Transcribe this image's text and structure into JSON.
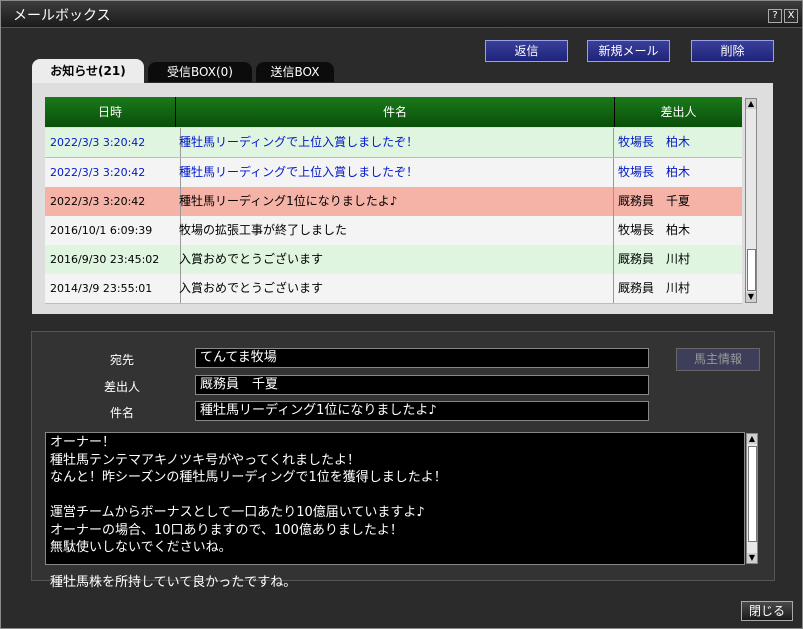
{
  "window": {
    "title": "メールボックス",
    "help": "?",
    "close": "X"
  },
  "actions": {
    "reply": "返信",
    "new_mail": "新規メール",
    "delete": "削除"
  },
  "tabs": [
    {
      "label": "お知らせ(21)"
    },
    {
      "label": "受信BOX(0)"
    },
    {
      "label": "送信BOX"
    }
  ],
  "table": {
    "columns": [
      "日時",
      "件名",
      "差出人"
    ],
    "rows": [
      {
        "date": "2022/3/3 3:20:42",
        "subject": "種牡馬リーディングで上位入賞しましたぞ！",
        "sender": "牧場長　柏木"
      },
      {
        "date": "2022/3/3 3:20:42",
        "subject": "種牡馬リーディングで上位入賞しましたぞ！",
        "sender": "牧場長　柏木"
      },
      {
        "date": "2022/3/3 3:20:42",
        "subject": "種牡馬リーディング1位になりましたよ♪",
        "sender": "厩務員　千夏"
      },
      {
        "date": "2016/10/1 6:09:39",
        "subject": "牧場の拡張工事が終了しました",
        "sender": "牧場長　柏木"
      },
      {
        "date": "2016/9/30 23:45:02",
        "subject": "入賞おめでとうございます",
        "sender": "厩務員　川村"
      },
      {
        "date": "2014/3/9 23:55:01",
        "subject": "入賞おめでとうございます",
        "sender": "厩務員　川村"
      }
    ]
  },
  "detail": {
    "to_label": "宛先",
    "to": "てんてま牧場",
    "from_label": "差出人",
    "from": "厩務員　千夏",
    "subject_label": "件名",
    "subject": "種牡馬リーディング1位になりましたよ♪",
    "owner_info": "馬主情報",
    "body": "オーナー！\n種牡馬テンテマアキノツキ号がやってくれましたよ！\nなんと！昨シーズンの種牡馬リーディングで1位を獲得しましたよ！\n\n運営チームからボーナスとして一口あたり10億届いていますよ♪\nオーナーの場合、10口ありますので、100億ありましたよ！\n無駄使いしないでくださいね。\n\n種牡馬株を所持していて良かったですね。"
  },
  "footer": {
    "close": "閉じる"
  },
  "colors": {
    "row_green": "#dff5df",
    "row_white": "#f4f4f4",
    "row_selected": "#f5b3a8",
    "link_blue": "#0018c8",
    "header_green": "#0a5e0a"
  }
}
